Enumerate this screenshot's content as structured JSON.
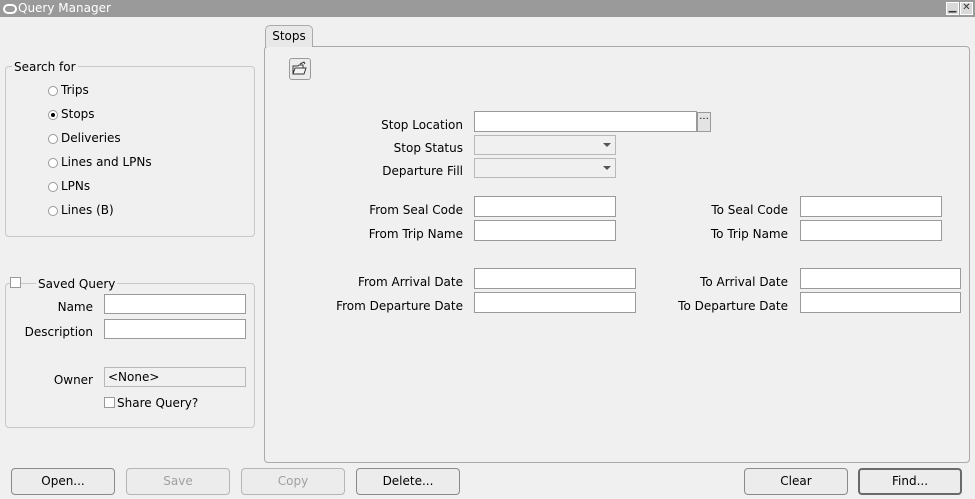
{
  "window": {
    "title": "Query Manager",
    "minimize_glyph": "▁",
    "close_glyph": "✕"
  },
  "search_for": {
    "legend": "Search for",
    "options": [
      {
        "label": "Trips",
        "selected": false
      },
      {
        "label": "Stops",
        "selected": true
      },
      {
        "label": "Deliveries",
        "selected": false
      },
      {
        "label": "Lines and LPNs",
        "selected": false
      },
      {
        "label": "LPNs",
        "selected": false
      },
      {
        "label": "Lines (B)",
        "selected": false
      }
    ]
  },
  "saved_query": {
    "legend": "Saved Query",
    "checked": false,
    "name_label": "Name",
    "name_value": "",
    "description_label": "Description",
    "description_value": "",
    "owner_label": "Owner",
    "owner_value": "<None>",
    "share_label": "Share Query?",
    "share_checked": false
  },
  "tab": {
    "label": "Stops",
    "toolbar_icon": "open-folder-icon"
  },
  "form": {
    "stop_location_label": "Stop Location",
    "stop_location_value": "",
    "lov_glyph": "···",
    "stop_status_label": "Stop Status",
    "stop_status_value": "",
    "departure_fill_label": "Departure Fill",
    "departure_fill_value": "",
    "from_seal_code_label": "From Seal Code",
    "to_seal_code_label": "To Seal Code",
    "from_trip_name_label": "From Trip Name",
    "to_trip_name_label": "To Trip Name",
    "from_arrival_date_label": "From Arrival Date",
    "to_arrival_date_label": "To Arrival Date",
    "from_departure_date_label": "From Departure Date",
    "to_departure_date_label": "To Departure Date"
  },
  "buttons": {
    "open": "Open...",
    "save": "Save",
    "copy": "Copy",
    "delete": "Delete...",
    "clear": "Clear",
    "find": "Find..."
  }
}
